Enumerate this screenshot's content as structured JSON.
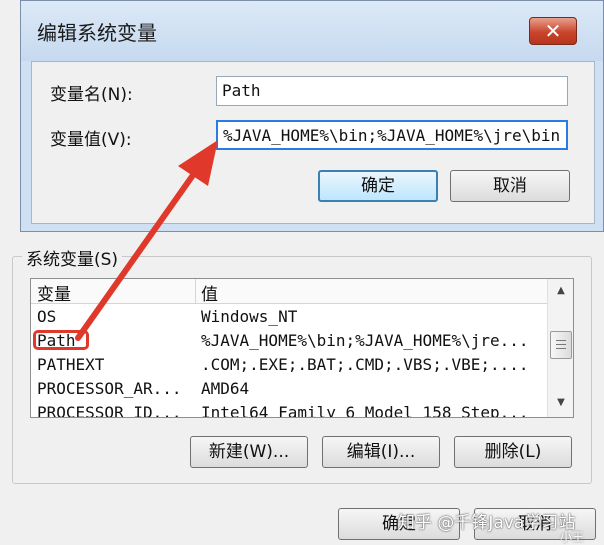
{
  "edit_dialog": {
    "title": "编辑系统变量",
    "close_symbol": "✕",
    "name_label": "变量名(N):",
    "name_value": "Path",
    "value_label": "变量值(V):",
    "value_value": "%JAVA_HOME%\\bin;%JAVA_HOME%\\jre\\bin",
    "ok_label": "确定",
    "cancel_label": "取消"
  },
  "system_vars": {
    "legend": "系统变量(S)",
    "columns": [
      "变量",
      "值"
    ],
    "rows": [
      {
        "name": "OS",
        "value": "Windows_NT"
      },
      {
        "name": "Path",
        "value": "%JAVA_HOME%\\bin;%JAVA_HOME%\\jre..."
      },
      {
        "name": "PATHEXT",
        "value": ".COM;.EXE;.BAT;.CMD;.VBS;.VBE;...."
      },
      {
        "name": "PROCESSOR_AR...",
        "value": "AMD64"
      },
      {
        "name": "PROCESSOR_ID...",
        "value": "Intel64 Family 6 Model 158 Step..."
      }
    ],
    "new_label": "新建(W)...",
    "edit_label": "编辑(I)...",
    "delete_label": "删除(L)"
  },
  "main": {
    "ok_label": "确定",
    "cancel_label": "取消"
  },
  "watermark": {
    "text": "知乎 @千锋Java学习站",
    "sub": "小王"
  },
  "colors": {
    "annotation": "#e0392b",
    "focus_blue": "#2c7be5"
  },
  "icons": {
    "close": "close-icon",
    "scroll_up": "chevron-up-icon",
    "scroll_down": "chevron-down-icon",
    "annotation_arrow": "arrow-icon"
  }
}
